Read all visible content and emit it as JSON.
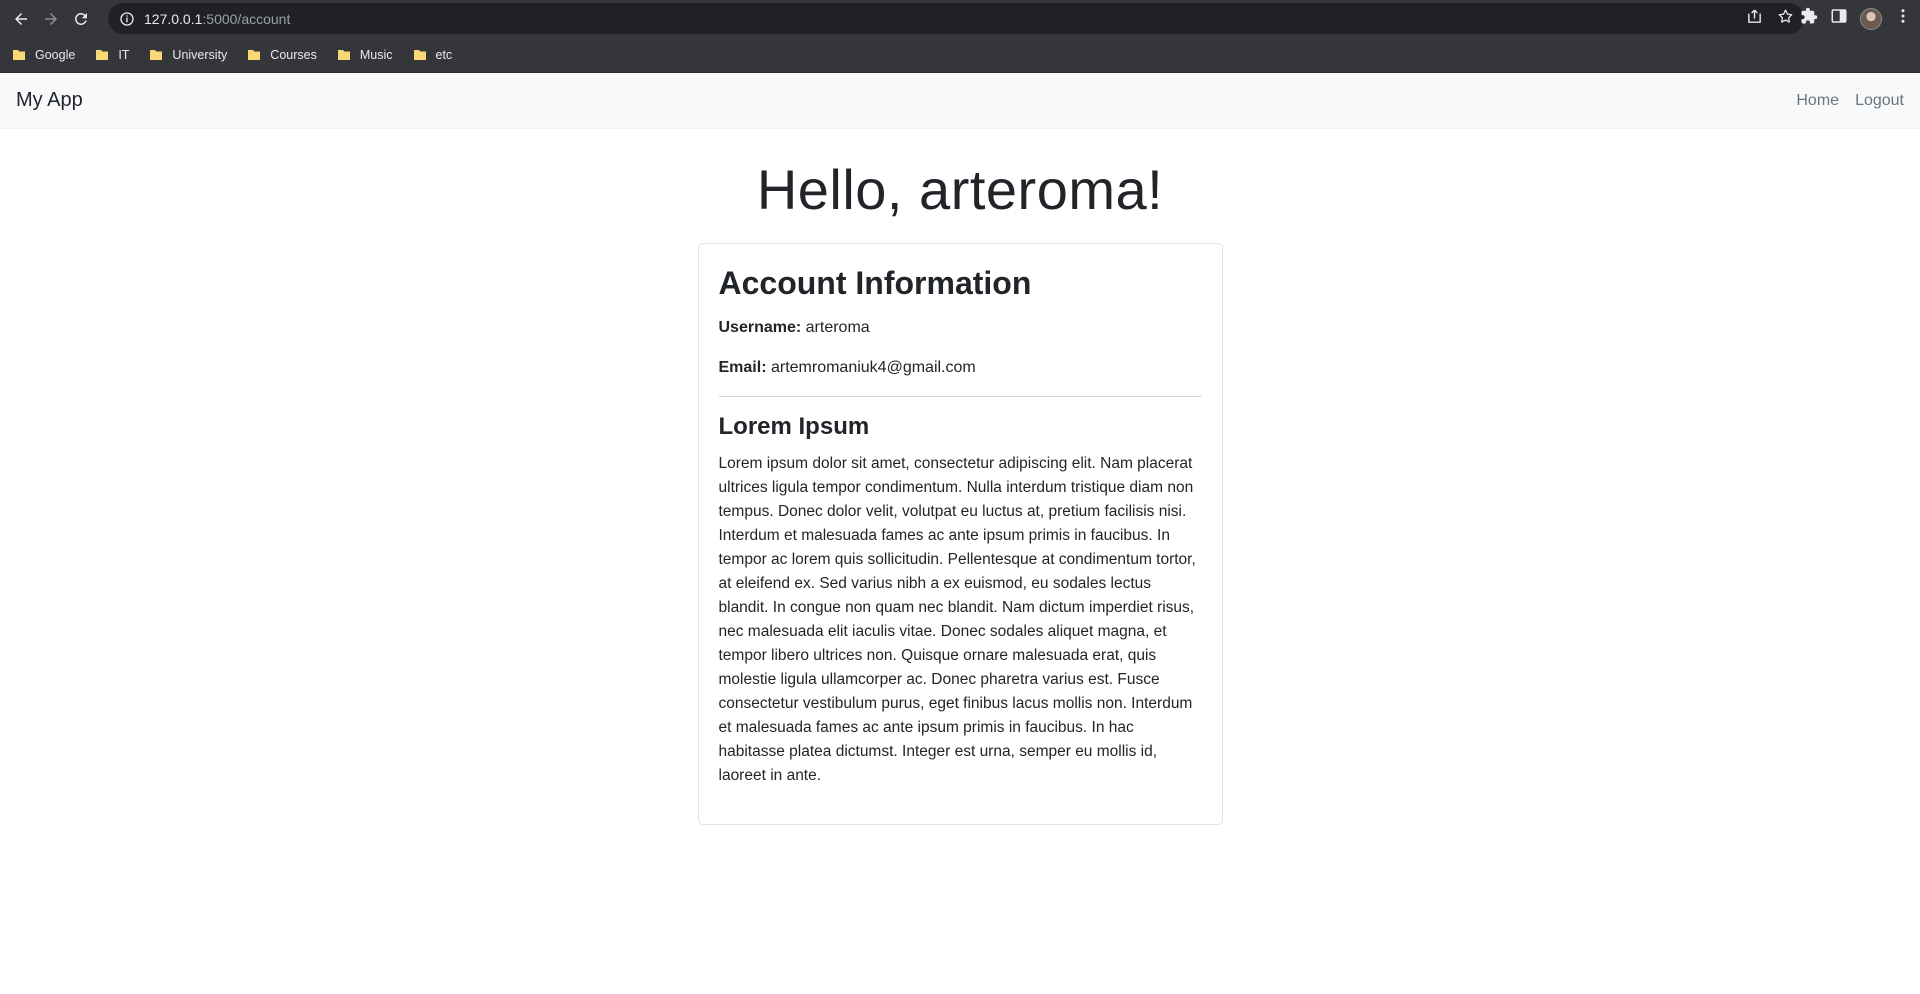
{
  "browser": {
    "url_host": "127.0.0.1",
    "url_path": ":5000/account",
    "bookmarks": [
      {
        "label": "Google"
      },
      {
        "label": "IT"
      },
      {
        "label": "University"
      },
      {
        "label": "Courses"
      },
      {
        "label": "Music"
      },
      {
        "label": "etc"
      }
    ],
    "colors": {
      "chrome": "#35363a",
      "omnibox": "#202124",
      "folder": "#f8d775"
    }
  },
  "navbar": {
    "brand": "My App",
    "links": [
      {
        "label": "Home"
      },
      {
        "label": "Logout"
      }
    ]
  },
  "page": {
    "greeting": "Hello, arteroma!",
    "card": {
      "title": "Account Information",
      "username_label": "Username:",
      "username_value": "arteroma",
      "email_label": "Email:",
      "email_value": "artemromaniuk4@gmail.com",
      "section_title": "Lorem Ipsum",
      "section_body": "Lorem ipsum dolor sit amet, consectetur adipiscing elit. Nam placerat ultrices ligula tempor condimentum. Nulla interdum tristique diam non tempus. Donec dolor velit, volutpat eu luctus at, pretium facilisis nisi. Interdum et malesuada fames ac ante ipsum primis in faucibus. In tempor ac lorem quis sollicitudin. Pellentesque at condimentum tortor, at eleifend ex. Sed varius nibh a ex euismod, eu sodales lectus blandit. In congue non quam nec blandit. Nam dictum imperdiet risus, nec malesuada elit iaculis vitae. Donec sodales aliquet magna, et tempor libero ultrices non. Quisque ornare malesuada erat, quis molestie ligula ullamcorper ac. Donec pharetra varius est. Fusce consectetur vestibulum purus, eget finibus lacus mollis non. Interdum et malesuada fames ac ante ipsum primis in faucibus. In hac habitasse platea dictumst. Integer est urna, semper eu mollis id, laoreet in ante."
    }
  }
}
